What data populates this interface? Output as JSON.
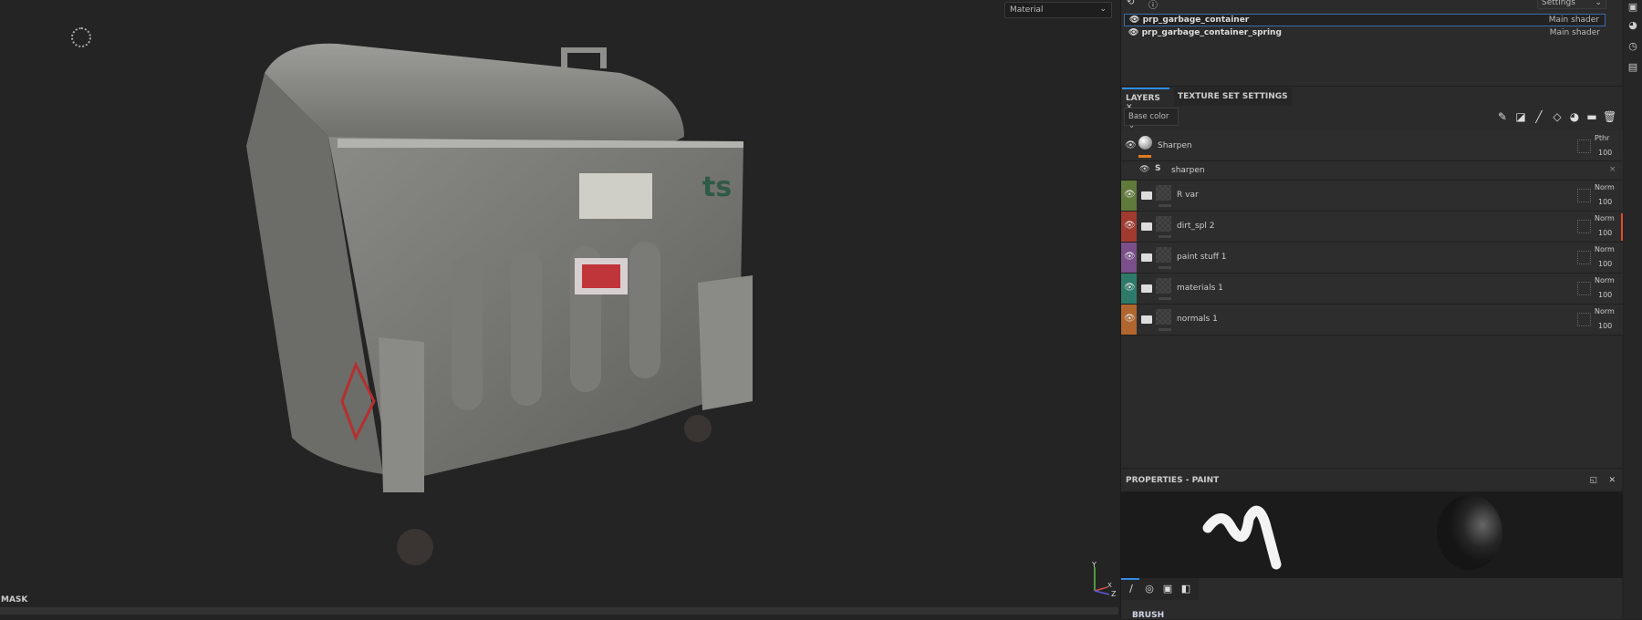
{
  "viewport": {
    "material_select": "Material",
    "mask_label": "MASK",
    "gizmo_axes": [
      "Y",
      "X",
      "Z"
    ]
  },
  "texture_sets": {
    "settings_label": "Settings",
    "items": [
      {
        "name": "prp_garbage_container",
        "shader": "Main shader",
        "selected": true
      },
      {
        "name": "prp_garbage_container_spring",
        "shader": "Main shader",
        "selected": false
      }
    ]
  },
  "layers_panel": {
    "tabs": [
      {
        "label": "LAYERS",
        "active": true
      },
      {
        "label": "TEXTURE SET SETTINGS",
        "active": false
      }
    ],
    "channel": "Base color",
    "filter": {
      "name": "Sharpen",
      "blend": "Pthr",
      "opacity": "100",
      "effect": "sharpen"
    },
    "layers": [
      {
        "name": "R var",
        "color": "#5f7a3a",
        "blend": "Norm",
        "opacity": "100"
      },
      {
        "name": "dirt_spl 2",
        "color": "#a13b2f",
        "blend": "Norm",
        "opacity": "100"
      },
      {
        "name": "paint stuff 1",
        "color": "#7a4f8a",
        "blend": "Norm",
        "opacity": "100"
      },
      {
        "name": "materials 1",
        "color": "#2e7a6a",
        "blend": "Norm",
        "opacity": "100"
      },
      {
        "name": "normals 1",
        "color": "#b0662e",
        "blend": "Norm",
        "opacity": "100"
      }
    ]
  },
  "properties": {
    "title": "PROPERTIES - PAINT",
    "section": "BRUSH"
  },
  "accent": "#2f8de4"
}
